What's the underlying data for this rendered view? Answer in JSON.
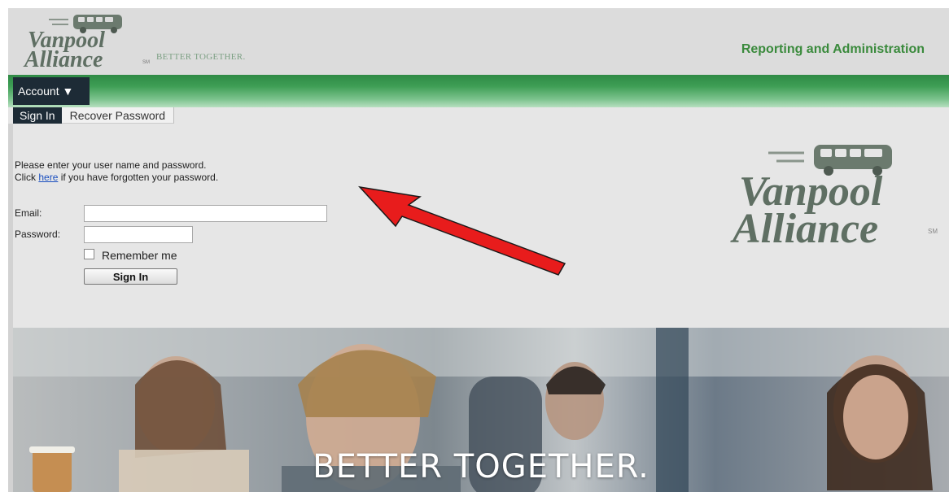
{
  "header": {
    "logo": {
      "line1": "Vanpool",
      "line2": "Alliance",
      "sm": "SM"
    },
    "tagline": "BETTER TOGETHER.",
    "section_title": "Reporting and Administration"
  },
  "nav": {
    "account_label": "Account ▼"
  },
  "tabs": [
    {
      "label": "Sign In",
      "active": true
    },
    {
      "label": "Recover Password",
      "active": false
    }
  ],
  "form": {
    "instruction_line1": "Please enter your user name and password.",
    "instruction_click": "Click ",
    "instruction_link": "here",
    "instruction_rest": " if you have forgotten your password.",
    "email_label": "Email:",
    "email_value": "",
    "password_label": "Password:",
    "password_value": "",
    "remember_label": "Remember me",
    "signin_label": "Sign In"
  },
  "big_logo": {
    "line1": "Vanpool",
    "line2": "Alliance",
    "sm": "SM"
  },
  "banner": {
    "text": "BETTER TOGETHER."
  },
  "colors": {
    "brand_green": "#3a8a3c",
    "nav_dark": "#1d2b36",
    "logo_gray": "#5f6f63",
    "arrow_red": "#e81c1c"
  },
  "icons": [
    "van-icon",
    "dropdown-arrow-icon",
    "checkbox-icon",
    "arrow-annotation-icon"
  ]
}
